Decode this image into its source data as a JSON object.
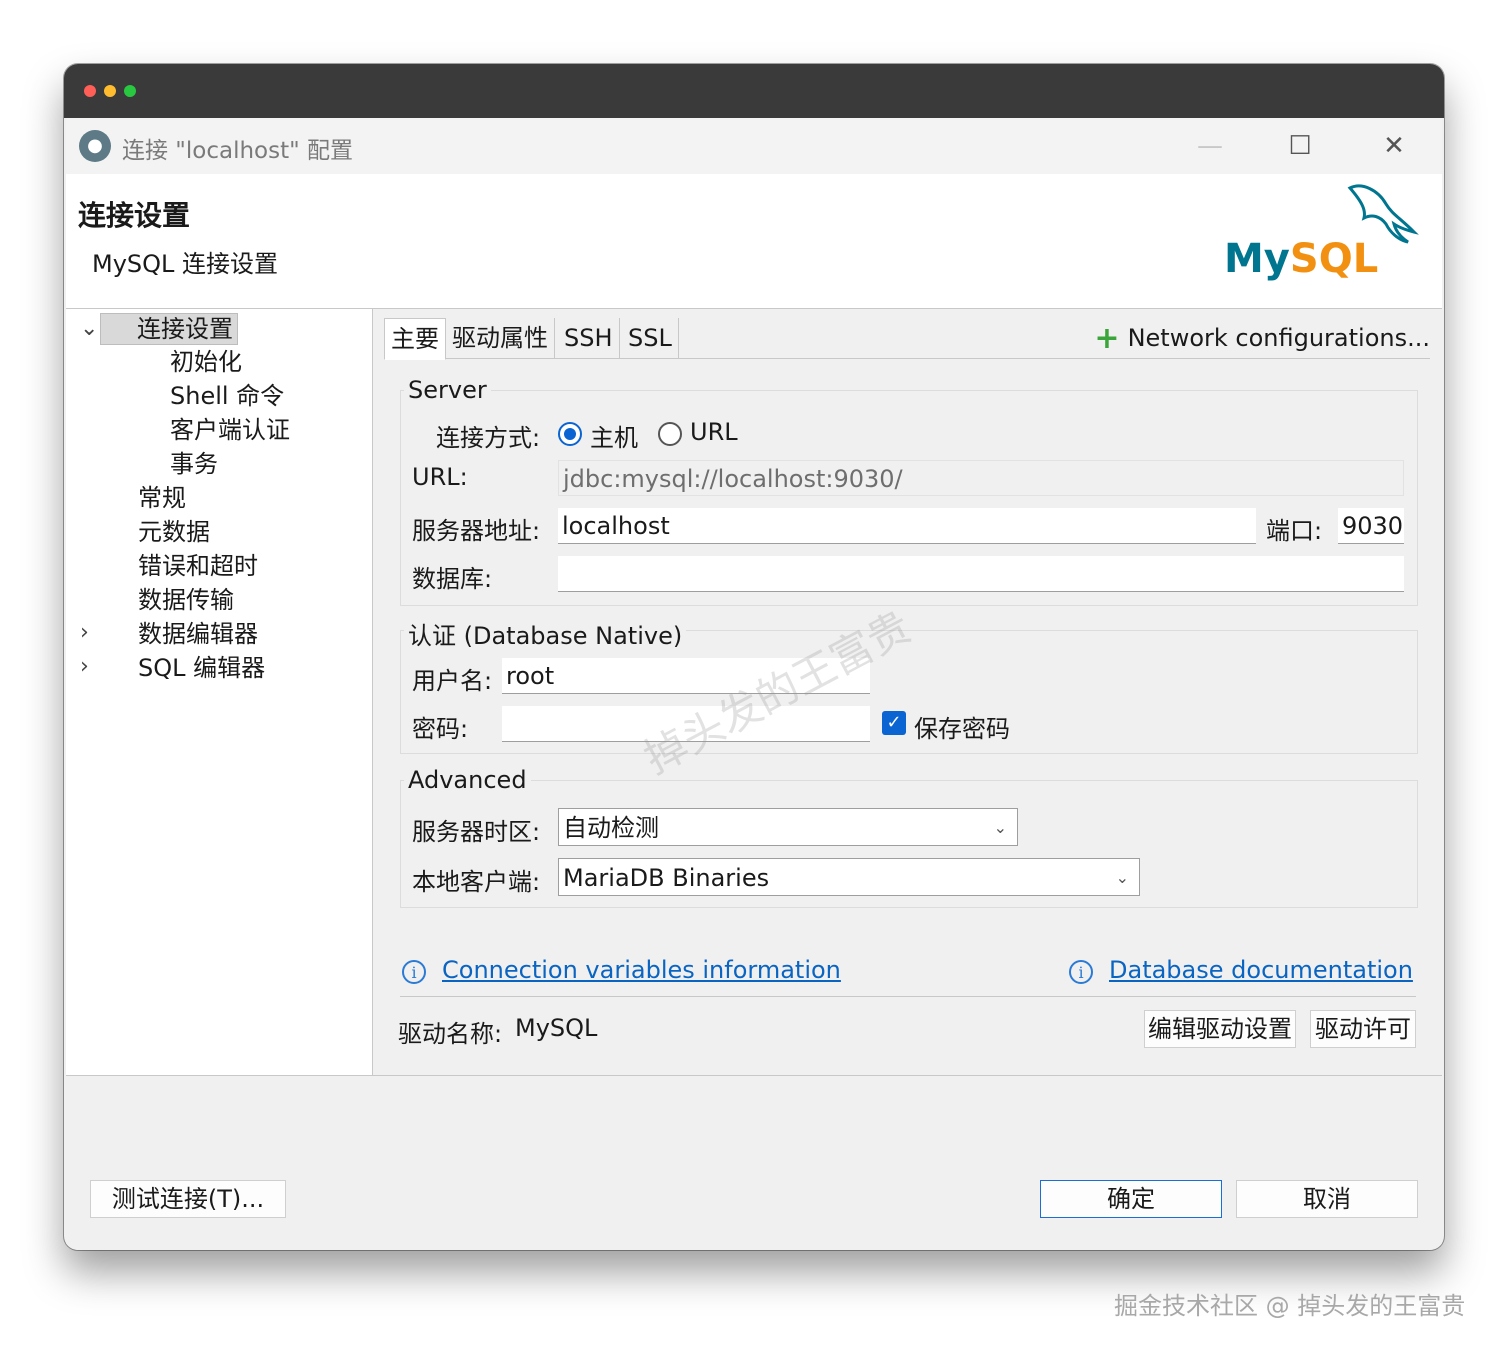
{
  "window": {
    "title": "连接 \"localhost\" 配置",
    "traffic_lights": {
      "close": "#ff5f57",
      "minimize": "#febc2e",
      "maximize": "#28c840"
    },
    "controls": {
      "minimize_icon": "minimize-icon",
      "maximize_icon": "maximize-icon",
      "close_icon": "close-icon"
    }
  },
  "header": {
    "title": "连接设置",
    "subtitle": "MySQL 连接设置",
    "logo": {
      "text_my": "My",
      "text_sql": "SQL",
      "color_my": "#00758f",
      "color_sql": "#f29111"
    }
  },
  "tree": {
    "items": [
      {
        "label": "连接设置",
        "expanded": true,
        "selected": true
      },
      {
        "label": "初始化"
      },
      {
        "label": "Shell 命令"
      },
      {
        "label": "客户端认证"
      },
      {
        "label": "事务"
      },
      {
        "label": "常规"
      },
      {
        "label": "元数据"
      },
      {
        "label": "错误和超时"
      },
      {
        "label": "数据传输"
      },
      {
        "label": "数据编辑器",
        "collapsed": true
      },
      {
        "label": "SQL 编辑器",
        "collapsed": true
      }
    ]
  },
  "tabs": [
    {
      "label": "主要",
      "active": true
    },
    {
      "label": "驱动属性"
    },
    {
      "label": "SSH"
    },
    {
      "label": "SSL"
    }
  ],
  "network_config": "Network configurations...",
  "server": {
    "group_label": "Server",
    "connect_by_label": "连接方式:",
    "option_host": "主机",
    "option_url": "URL",
    "selected": "主机",
    "url_label": "URL:",
    "url_value": "jdbc:mysql://localhost:9030/",
    "host_label": "服务器地址:",
    "host_value": "localhost",
    "port_label": "端口:",
    "port_value": "9030",
    "database_label": "数据库:",
    "database_value": ""
  },
  "auth": {
    "group_label": "认证 (Database Native)",
    "username_label": "用户名:",
    "username_value": "root",
    "password_label": "密码:",
    "password_value": "",
    "save_password_label": "保存密码",
    "save_password_checked": true
  },
  "advanced": {
    "group_label": "Advanced",
    "timezone_label": "服务器时区:",
    "timezone_value": "自动检测",
    "client_label": "本地客户端:",
    "client_value": "MariaDB Binaries"
  },
  "links": {
    "conn_vars": "Connection variables information",
    "db_docs": "Database documentation"
  },
  "driver": {
    "label": "驱动名称:",
    "name": "MySQL",
    "edit_button": "编辑驱动设置",
    "license_button": "驱动许可"
  },
  "footer": {
    "test_button": "测试连接(T)...",
    "ok_button": "确定",
    "cancel_button": "取消"
  },
  "watermark": "掉头发的王富贵",
  "credit": "掘金技术社区 @ 掉头发的王富贵"
}
